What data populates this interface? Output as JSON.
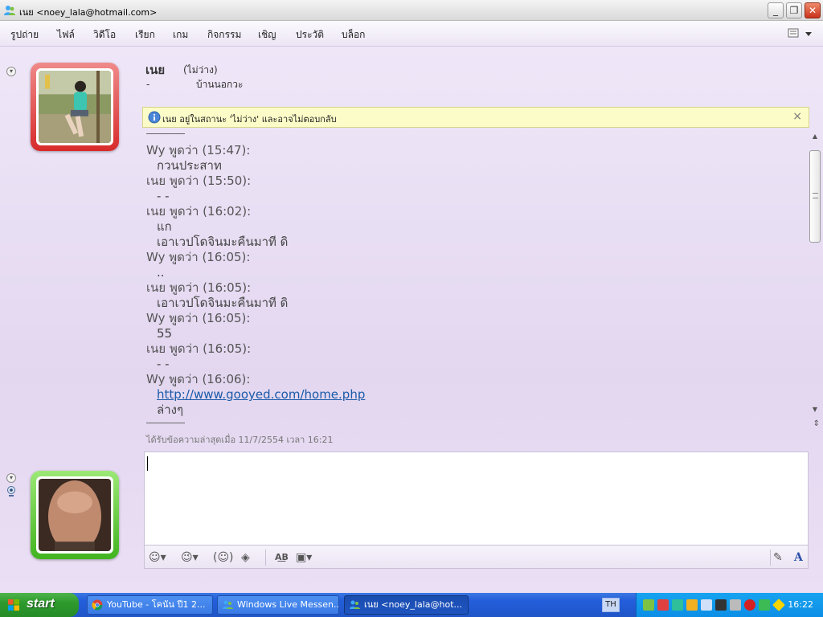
{
  "window": {
    "title": "เนย <noey_lala@hotmail.com>"
  },
  "menu": {
    "items": [
      "รูปถ่าย",
      "ไฟล์",
      "วิดีโอ",
      "เรียก",
      "เกม",
      "กิจกรรม",
      "เชิญ",
      "ประวัติ",
      "บล็อก"
    ]
  },
  "contact": {
    "name": "เนย",
    "status": "(ไม่ว่าง)",
    "dash": "-",
    "personal_message": "บ้านนอกวะ"
  },
  "notice": {
    "text": "เนย อยู่ในสถานะ 'ไม่ว่าง' และอาจไม่ตอบกลับ"
  },
  "chat": {
    "lines": [
      {
        "kind": "header",
        "text": "Wy พูดว่า (15:47):"
      },
      {
        "kind": "msg",
        "text": "กวนประสาท"
      },
      {
        "kind": "header",
        "text": "เนย พูดว่า (15:50):"
      },
      {
        "kind": "msg",
        "text": "- -"
      },
      {
        "kind": "header",
        "text": "เนย พูดว่า (16:02):"
      },
      {
        "kind": "msg",
        "text": "แก"
      },
      {
        "kind": "msg",
        "text": "เอาเวปโดจินมะคืนมาที ดิ"
      },
      {
        "kind": "header",
        "text": "Wy พูดว่า (16:05):"
      },
      {
        "kind": "msg",
        "text": ".."
      },
      {
        "kind": "header",
        "text": "เนย พูดว่า (16:05):"
      },
      {
        "kind": "msg",
        "text": "เอาเวปโดจินมะคืนมาที ดิ"
      },
      {
        "kind": "header",
        "text": "Wy พูดว่า (16:05):"
      },
      {
        "kind": "msg",
        "text": "55"
      },
      {
        "kind": "header",
        "text": "เนย พูดว่า (16:05):"
      },
      {
        "kind": "msg",
        "text": "- -"
      },
      {
        "kind": "header",
        "text": "Wy พูดว่า (16:06):"
      },
      {
        "kind": "link",
        "text": "http://www.gooyed.com/home.php"
      },
      {
        "kind": "msg",
        "text": "ล่างๆ"
      }
    ],
    "last_received": "ได้รับข้อความล่าสุดเมื่อ 11/7/2554 เวลา 16:21"
  },
  "input": {
    "value": ""
  },
  "toolbar": {
    "icons": [
      "emoticon-icon",
      "wink-icon",
      "nudge-icon",
      "voice-clip-icon",
      "spellcheck-icon",
      "background-icon",
      "handwriting-icon",
      "font-icon"
    ]
  },
  "taskbar": {
    "start_label": "start",
    "tasks": [
      {
        "label": "YouTube - โคนัน ปี1 2...",
        "icon": "chrome-icon"
      },
      {
        "label": "Windows Live Messen...",
        "icon": "messenger-icon"
      },
      {
        "label": "เนย <noey_lala@hot...",
        "icon": "messenger-icon",
        "active": true
      }
    ],
    "language": "TH",
    "clock": "16:22"
  },
  "colors": {
    "accent_purple": "#e3d7f0",
    "notice_yellow": "#fcfcc8",
    "link_blue": "#1a5aa8",
    "taskbar_blue": "#245edb",
    "start_green": "#2e9a2e",
    "avatar_red": "#d72b2b",
    "avatar_green": "#41b41f"
  }
}
